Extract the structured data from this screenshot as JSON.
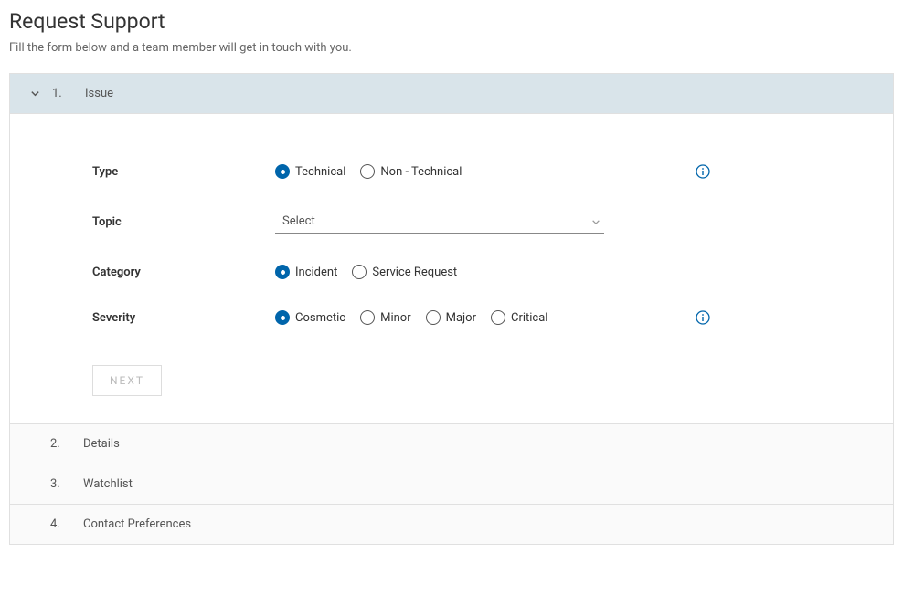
{
  "page": {
    "title": "Request Support",
    "subtitle": "Fill the form below and a team member will get in touch with you."
  },
  "steps": {
    "s1": {
      "number": "1.",
      "title": "Issue"
    },
    "s2": {
      "number": "2.",
      "title": "Details"
    },
    "s3": {
      "number": "3.",
      "title": "Watchlist"
    },
    "s4": {
      "number": "4.",
      "title": "Contact Preferences"
    }
  },
  "form": {
    "type": {
      "label": "Type",
      "options": {
        "technical": "Technical",
        "nontechnical": "Non - Technical"
      }
    },
    "topic": {
      "label": "Topic",
      "placeholder": "Select"
    },
    "category": {
      "label": "Category",
      "options": {
        "incident": "Incident",
        "service": "Service Request"
      }
    },
    "severity": {
      "label": "Severity",
      "options": {
        "cosmetic": "Cosmetic",
        "minor": "Minor",
        "major": "Major",
        "critical": "Critical"
      }
    },
    "next": "NEXT"
  }
}
